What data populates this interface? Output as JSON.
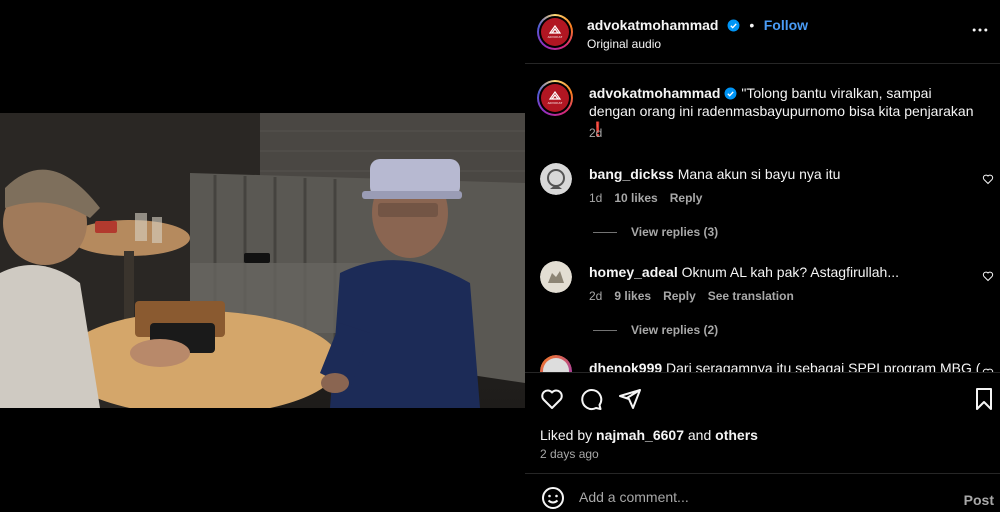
{
  "post": {
    "username": "advokatmohammad",
    "follow_label": "Follow",
    "separator": "•",
    "audio": "Original audio",
    "logo_text": "ADVOKAT MOHAMMAD"
  },
  "caption": {
    "username": "advokatmohammad",
    "text": "\"Tolong bantu viralkan, sampai dengan orang ini radenmasbayupurnomo bisa kita penjarakan",
    "emoji": "❗",
    "time": "2d"
  },
  "comments": [
    {
      "username": "bang_dickss",
      "text": "Mana akun si bayu nya itu",
      "time": "1d",
      "likes": "10 likes",
      "reply_label": "Reply",
      "view_replies": "View replies (3)"
    },
    {
      "username": "homey_adeal",
      "text": "Oknum AL kah pak? Astagfirullah...",
      "time": "2d",
      "likes": "9 likes",
      "reply_label": "Reply",
      "translation_label": "See translation",
      "view_replies": "View replies (2)"
    },
    {
      "username": "dhenok999",
      "text": "Dari seragamnya itu sebagai SPPI program MBG ("
    }
  ],
  "likes": {
    "prefix": "Liked by",
    "user": "najmah_6607",
    "and": "and",
    "others": "others"
  },
  "time_ago": "2 days ago",
  "composer": {
    "placeholder": "Add a comment...",
    "post_label": "Post"
  },
  "colors": {
    "accent_blue": "#4a9cf6",
    "brand_red": "#b11622",
    "muted_text": "#a8a8a8"
  },
  "icons": [
    "more-options-icon",
    "verified-badge-icon",
    "heart-icon",
    "comment-icon",
    "share-icon",
    "bookmark-icon",
    "emoji-icon",
    "mute-icon"
  ]
}
